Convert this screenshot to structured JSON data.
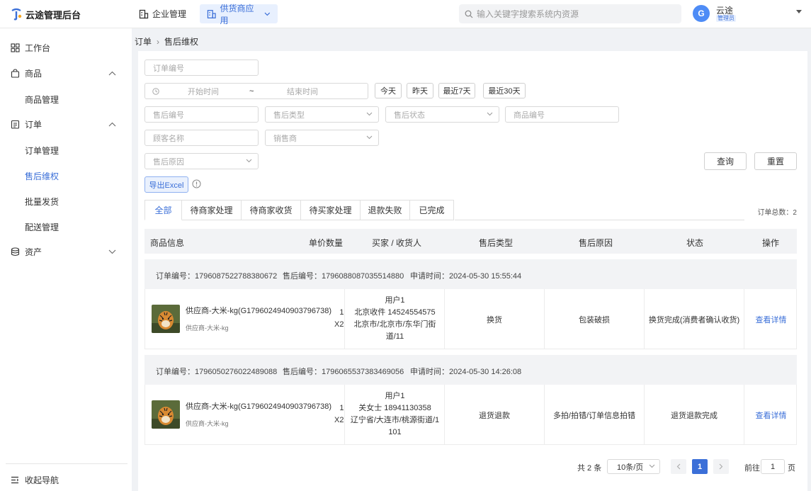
{
  "app": {
    "title": "云途管理后台"
  },
  "topnav": {
    "enterprise": "企业管理",
    "supply": "供货商应用"
  },
  "search": {
    "placeholder": "输入关键字搜索系统内资源"
  },
  "user": {
    "initial": "G",
    "name": "云途",
    "role": "管理员"
  },
  "sidebar": {
    "workbench": "工作台",
    "goods": "商品",
    "goods_manage": "商品管理",
    "order": "订单",
    "order_manage": "订单管理",
    "after_sale": "售后维权",
    "batch_ship": "批量发货",
    "delivery": "配送管理",
    "assets": "资产",
    "collapse": "收起导航"
  },
  "breadcrumb": {
    "root": "订单",
    "sep": "›",
    "current": "售后维权"
  },
  "filters": {
    "order_no": "订单编号",
    "start_time": "开始时间",
    "range_sep": "~",
    "end_time": "结束时间",
    "today": "今天",
    "yesterday": "昨天",
    "last7": "最近7天",
    "last30": "最近30天",
    "after_no": "售后编号",
    "after_type": "售后类型",
    "after_status": "售后状态",
    "goods_no": "商品编号",
    "customer": "顾客名称",
    "seller": "销售商",
    "reason": "售后原因",
    "query": "查询",
    "reset": "重置",
    "export": "导出Excel"
  },
  "tabs": [
    "全部",
    "待商家处理",
    "待商家收货",
    "待买家处理",
    "退款失败",
    "已完成"
  ],
  "total": "订单总数：2",
  "columns": {
    "goods": "商品信息",
    "price_qty": "单价数量",
    "buyer": "买家 / 收货人",
    "type": "售后类型",
    "reason": "售后原因",
    "status": "状态",
    "action": "操作"
  },
  "orders": [
    {
      "order_no": "订单编号：1796087522788380672",
      "after_no": "售后编号：1796088087035514880",
      "apply_time": "申请时间：2024-05-30 15:55:44",
      "product": "供应商-大米-kg(G1796024940903796738)",
      "product_sub": "供应商-大米-kg",
      "price": "1",
      "qty": "X2",
      "buyer_l1": "用户1",
      "buyer_l2": "北京收件 14524554575",
      "buyer_l3": "北京市/北京市/东华门街",
      "buyer_l4": "道/11",
      "type": "换货",
      "reason": "包装破损",
      "status": "换货完成(消费者确认收货)",
      "action": "查看详情"
    },
    {
      "order_no": "订单编号：1796050276022489088",
      "after_no": "售后编号：1796065537383469056",
      "apply_time": "申请时间：2024-05-30 14:26:08",
      "product": "供应商-大米-kg(G1796024940903796738)",
      "product_sub": "供应商-大米-kg",
      "price": "1",
      "qty": "X2",
      "buyer_l1": "用户1",
      "buyer_l2": "关女士 18941130358",
      "buyer_l3": "辽宁省/大连市/桃源街道/1",
      "buyer_l4": "101",
      "type": "退货退款",
      "reason": "多拍/拍错/订单信息拍错",
      "status": "退货退款完成",
      "action": "查看详情"
    }
  ],
  "pagination": {
    "total": "共 2 条",
    "size": "10条/页",
    "current": "1",
    "goto": "前往",
    "goto_value": "1",
    "unit": "页"
  },
  "colors": {
    "accent": "#3b6fd8",
    "avatar": "#4e8cf6"
  }
}
